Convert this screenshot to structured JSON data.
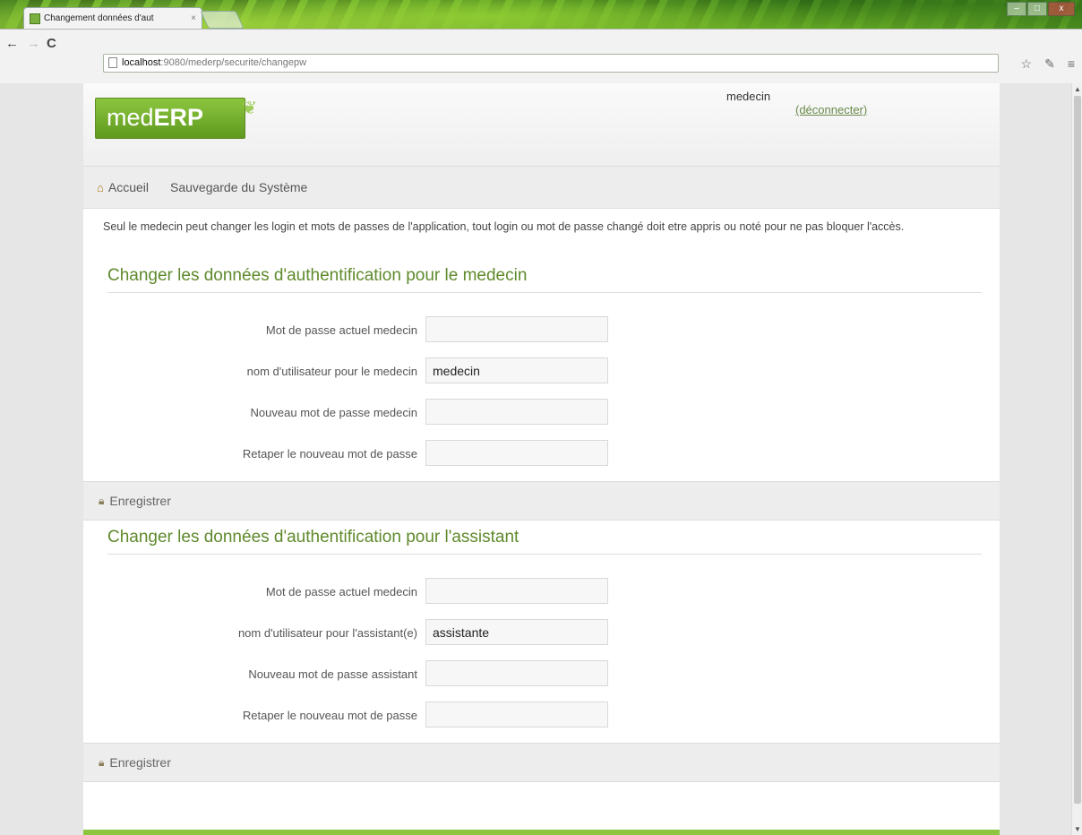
{
  "browser": {
    "tab_title": "Changement données d'aut",
    "tab_close": "×",
    "url_host": "localhost",
    "url_rest": ":9080/mederp/securite/changepw"
  },
  "header": {
    "logo_prefix": "med",
    "logo_bold": "ERP",
    "user_name": "medecin",
    "logout_label": "(déconnecter)"
  },
  "menu": {
    "home_label": "Accueil",
    "backup_label": "Sauvegarde du Système"
  },
  "intro_text": "Seul le medecin peut changer les login et mots de passes de l'application, tout login ou mot de passe changé doit etre appris ou noté pour ne pas bloquer l'accès.",
  "medecin_section": {
    "title": "Changer les données d'authentification pour le medecin",
    "current_pw_label": "Mot de passe actuel medecin",
    "username_label": "nom d'utilisateur pour le medecin",
    "username_value": "medecin",
    "new_pw_label": "Nouveau mot de passe medecin",
    "retype_label": "Retaper le nouveau mot de passe",
    "save_label": "Enregistrer"
  },
  "assistant_section": {
    "title": "Changer les données d'authentification pour l'assistant",
    "current_pw_label": "Mot de passe actuel medecin",
    "username_label": "nom d'utilisateur pour l'assistant(e)",
    "username_value": "assistante",
    "new_pw_label": "Nouveau mot de passe assistant",
    "retype_label": "Retaper le nouveau mot de passe",
    "save_label": "Enregistrer"
  },
  "icons": {
    "home": "house-icon",
    "save": "lock-icon"
  },
  "colors": {
    "brand_green": "#8cc63f",
    "title_green": "#5f8a2c"
  }
}
